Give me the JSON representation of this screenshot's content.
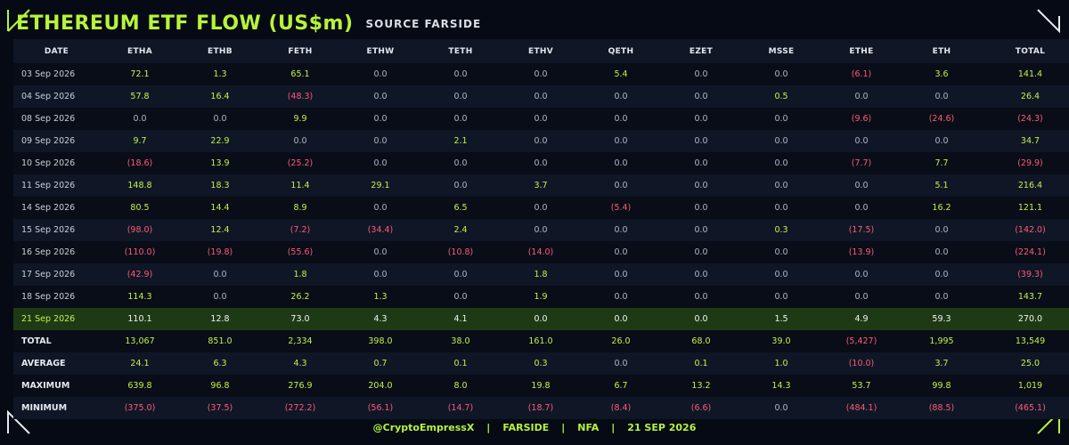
{
  "header": {
    "title": "ETHEREUM ETF FLOW (US$m)",
    "subtitle": "SOURCE  FARSIDE"
  },
  "footer": {
    "handle": "@CryptoEmpressX",
    "source": "FARSIDE",
    "nfa": "NFA",
    "date": "21 SEP 2026",
    "sep": "|"
  },
  "colors": {
    "accent": "#b6f43a",
    "negative": "#ff5a75",
    "highlight_row": "#1e3a14",
    "background": "#060a14"
  },
  "chart_data": {
    "type": "table",
    "title": "ETHEREUM ETF FLOW (US$m)",
    "columns": [
      "DATE",
      "ETHA",
      "ETHB",
      "FETH",
      "ETHW",
      "TETH",
      "ETHV",
      "QETH",
      "EZET",
      "MSSE",
      "ETHE",
      "ETH",
      "TOTAL"
    ],
    "highlight_row": "21 Sep 2026",
    "rows": [
      [
        "03 Sep 2026",
        "72.1",
        "1.3",
        "65.1",
        "0.0",
        "0.0",
        "0.0",
        "5.4",
        "0.0",
        "0.0",
        "(6.1)",
        "3.6",
        "141.4"
      ],
      [
        "04 Sep 2026",
        "57.8",
        "16.4",
        "(48.3)",
        "0.0",
        "0.0",
        "0.0",
        "0.0",
        "0.0",
        "0.5",
        "0.0",
        "0.0",
        "26.4"
      ],
      [
        "08 Sep 2026",
        "0.0",
        "0.0",
        "9.9",
        "0.0",
        "0.0",
        "0.0",
        "0.0",
        "0.0",
        "0.0",
        "(9.6)",
        "(24.6)",
        "(24.3)"
      ],
      [
        "09 Sep 2026",
        "9.7",
        "22.9",
        "0.0",
        "0.0",
        "2.1",
        "0.0",
        "0.0",
        "0.0",
        "0.0",
        "0.0",
        "0.0",
        "34.7"
      ],
      [
        "10 Sep 2026",
        "(18.6)",
        "13.9",
        "(25.2)",
        "0.0",
        "0.0",
        "0.0",
        "0.0",
        "0.0",
        "0.0",
        "(7.7)",
        "7.7",
        "(29.9)"
      ],
      [
        "11 Sep 2026",
        "148.8",
        "18.3",
        "11.4",
        "29.1",
        "0.0",
        "3.7",
        "0.0",
        "0.0",
        "0.0",
        "0.0",
        "5.1",
        "216.4"
      ],
      [
        "14 Sep 2026",
        "80.5",
        "14.4",
        "8.9",
        "0.0",
        "6.5",
        "0.0",
        "(5.4)",
        "0.0",
        "0.0",
        "0.0",
        "16.2",
        "121.1"
      ],
      [
        "15 Sep 2026",
        "(98.0)",
        "12.4",
        "(7.2)",
        "(34.4)",
        "2.4",
        "0.0",
        "0.0",
        "0.0",
        "0.3",
        "(17.5)",
        "0.0",
        "(142.0)"
      ],
      [
        "16 Sep 2026",
        "(110.0)",
        "(19.8)",
        "(55.6)",
        "0.0",
        "(10.8)",
        "(14.0)",
        "0.0",
        "0.0",
        "0.0",
        "(13.9)",
        "0.0",
        "(224.1)"
      ],
      [
        "17 Sep 2026",
        "(42.9)",
        "0.0",
        "1.8",
        "0.0",
        "0.0",
        "1.8",
        "0.0",
        "0.0",
        "0.0",
        "0.0",
        "0.0",
        "(39.3)"
      ],
      [
        "18 Sep 2026",
        "114.3",
        "0.0",
        "26.2",
        "1.3",
        "0.0",
        "1.9",
        "0.0",
        "0.0",
        "0.0",
        "0.0",
        "0.0",
        "143.7"
      ],
      [
        "21 Sep 2026",
        "110.1",
        "12.8",
        "73.0",
        "4.3",
        "4.1",
        "0.0",
        "0.0",
        "0.0",
        "1.5",
        "4.9",
        "59.3",
        "270.0"
      ]
    ],
    "summary": [
      [
        "TOTAL",
        "13,067",
        "851.0",
        "2,334",
        "398.0",
        "38.0",
        "161.0",
        "26.0",
        "68.0",
        "39.0",
        "(5,427)",
        "1,995",
        "13,549"
      ],
      [
        "AVERAGE",
        "24.1",
        "6.3",
        "4.3",
        "0.7",
        "0.1",
        "0.3",
        "0.0",
        "0.1",
        "1.0",
        "(10.0)",
        "3.7",
        "25.0"
      ],
      [
        "MAXIMUM",
        "639.8",
        "96.8",
        "276.9",
        "204.0",
        "8.0",
        "19.8",
        "6.7",
        "13.2",
        "14.3",
        "53.7",
        "99.8",
        "1,019"
      ],
      [
        "MINIMUM",
        "(375.0)",
        "(37.5)",
        "(272.2)",
        "(56.1)",
        "(14.7)",
        "(18.7)",
        "(8.4)",
        "(6.6)",
        "0.0",
        "(484.1)",
        "(88.5)",
        "(465.1)"
      ]
    ]
  }
}
